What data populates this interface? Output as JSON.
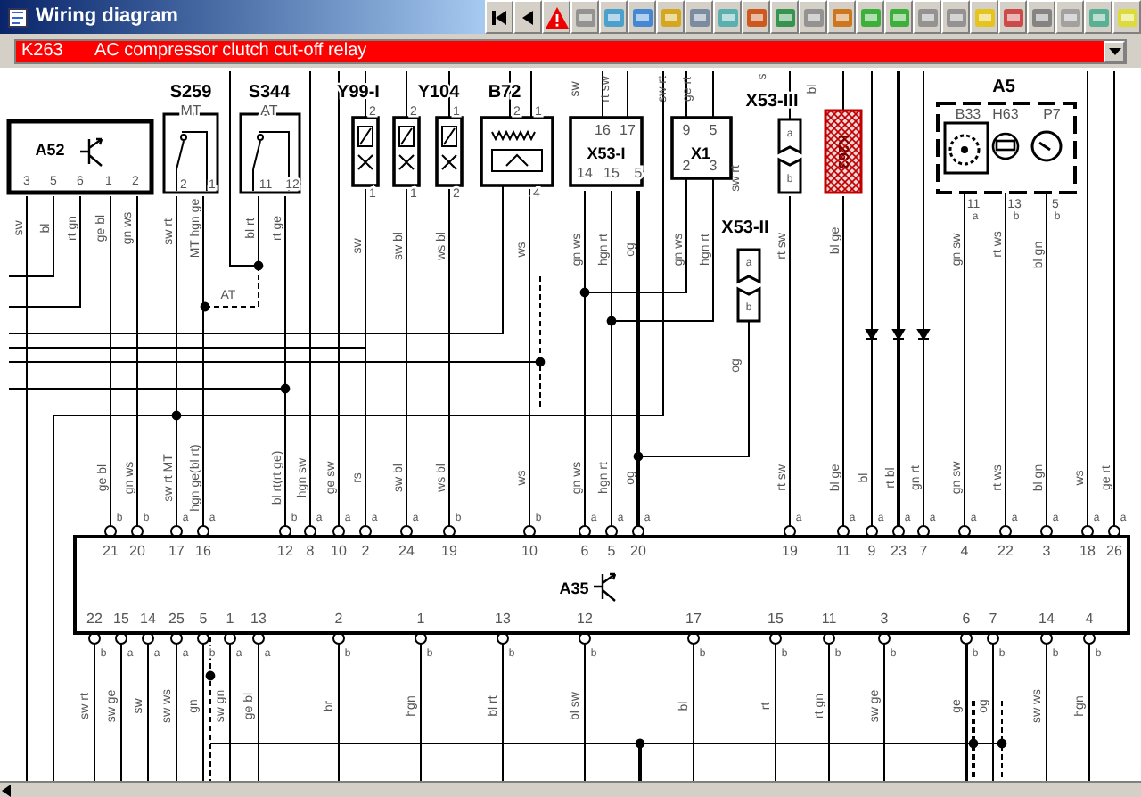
{
  "window": {
    "title": "Wiring diagram"
  },
  "component_select": {
    "code": "K263",
    "description": "AC compressor clutch cut-off relay"
  },
  "top_wire_labels": [
    "sw",
    "rt sw",
    "sw rt",
    "ge rt",
    "s",
    "bl"
  ],
  "components": [
    {
      "kind": "control-unit",
      "name": "A52",
      "bottom_pins": [
        "3",
        "5",
        "6",
        "1",
        "2"
      ],
      "wires": [
        "sw",
        "bl",
        "rt gn",
        "ge bl",
        "gn ws"
      ]
    },
    {
      "kind": "switch",
      "name": "S259",
      "sublabel": "MT",
      "bottom_pins": [
        "2",
        "1"
      ],
      "wires": [
        "sw rt",
        "MT hgn ge"
      ]
    },
    {
      "kind": "switch",
      "name": "S344",
      "sublabel": "AT",
      "bottom_pins": [
        "11",
        "12"
      ],
      "wires": [
        "bl rt",
        "rt ge"
      ]
    },
    {
      "kind": "valve",
      "name": "Y99-I",
      "top_pins": [
        "2"
      ],
      "bottom_pins": [
        "1"
      ],
      "wires": [
        "sw"
      ]
    },
    {
      "kind": "valve",
      "top_pins": [
        "2"
      ],
      "bottom_pins": [
        "1"
      ],
      "wires": [
        "sw bl"
      ]
    },
    {
      "kind": "valve",
      "name": "Y104",
      "top_pins": [
        "1"
      ],
      "bottom_pins": [
        "2"
      ],
      "wires": [
        "ws bl"
      ]
    },
    {
      "kind": "sensor",
      "name": "B72",
      "top_pins": [
        "2",
        "1"
      ],
      "bottom_pins": [
        "4"
      ],
      "wires": [
        "ws"
      ]
    },
    {
      "kind": "connector-block",
      "name": "X53-I",
      "top_pins": [
        "16",
        "17"
      ],
      "bottom_pins": [
        "14",
        "15",
        "5"
      ],
      "wires": [
        "gn ws",
        "hgn rt",
        "og"
      ]
    },
    {
      "kind": "connector-block",
      "name": "X1",
      "top_pins": [
        "9",
        "5"
      ],
      "bottom_pins": [
        "2",
        "3"
      ],
      "wires": [
        "gn ws",
        "hgn rt",
        "sw rt"
      ]
    },
    {
      "kind": "plug",
      "name": "X53-II",
      "contacts": [
        "a",
        "b"
      ],
      "wires": [
        "og"
      ]
    },
    {
      "kind": "plug",
      "name": "X53-III",
      "contacts": [
        "a",
        "b"
      ],
      "wires": [
        "rt sw"
      ]
    },
    {
      "kind": "relay",
      "name": "K263",
      "wires": [
        "bl ge"
      ]
    },
    {
      "kind": "instrument-group",
      "name": "A5",
      "parts": [
        "B33",
        "H63",
        "P7"
      ],
      "bottom_pins": [
        {
          "number": "11",
          "contact": "a"
        },
        {
          "number": "13",
          "contact": "b"
        },
        {
          "number": "5",
          "contact": "b"
        }
      ],
      "wires": [
        "gn sw",
        "rt ws",
        "bl gn"
      ]
    }
  ],
  "line_labels": [
    "AT"
  ],
  "a35": {
    "name": "A35",
    "top_pins": [
      {
        "number": "21",
        "contact": "b",
        "wire": "ge bl"
      },
      {
        "number": "20",
        "contact": "b",
        "wire": "gn ws"
      },
      {
        "number": "17",
        "contact": "a",
        "wire": "sw rt MT"
      },
      {
        "number": "16",
        "contact": "a",
        "wire": "hgn ge(bl rt)"
      },
      {
        "number": "12",
        "contact": "b",
        "wire": "bl rt(rt ge)"
      },
      {
        "number": "8",
        "contact": "a",
        "wire": "hgn sw"
      },
      {
        "number": "10",
        "contact": "a",
        "wire": "ge sw"
      },
      {
        "number": "2",
        "contact": "a",
        "wire": "rs"
      },
      {
        "number": "24",
        "contact": "a",
        "wire": "sw bl"
      },
      {
        "number": "19",
        "contact": "b",
        "wire": "ws bl"
      },
      {
        "number": "10",
        "contact": "b",
        "wire": "ws"
      },
      {
        "number": "6",
        "contact": "a",
        "wire": "gn ws"
      },
      {
        "number": "5",
        "contact": "a",
        "wire": "hgn rt"
      },
      {
        "number": "20",
        "contact": "a",
        "wire": "og"
      },
      {
        "number": "19",
        "contact": "a",
        "wire": "rt sw"
      },
      {
        "number": "11",
        "contact": "a",
        "wire": "bl ge"
      },
      {
        "number": "9",
        "contact": "a",
        "wire": "bl"
      },
      {
        "number": "23",
        "contact": "a",
        "wire": "rt bl"
      },
      {
        "number": "7",
        "contact": "a",
        "wire": "gn rt"
      },
      {
        "number": "4",
        "contact": "a",
        "wire": "gn sw"
      },
      {
        "number": "22",
        "contact": "a",
        "wire": "rt ws"
      },
      {
        "number": "3",
        "contact": "a",
        "wire": "bl gn"
      },
      {
        "number": "18",
        "contact": "a",
        "wire": "ws"
      },
      {
        "number": "26",
        "contact": "a",
        "wire": "ge rt"
      }
    ],
    "bottom_pins": [
      {
        "number": "22",
        "contact": "b",
        "wire": "sw rt"
      },
      {
        "number": "15",
        "contact": "a",
        "wire": "sw ge"
      },
      {
        "number": "14",
        "contact": "a",
        "wire": "sw"
      },
      {
        "number": "25",
        "contact": "a",
        "wire": "sw ws"
      },
      {
        "number": "5",
        "contact": "b",
        "wire": "gn"
      },
      {
        "number": "1",
        "contact": "a",
        "wire": "sw gn"
      },
      {
        "number": "13",
        "contact": "a",
        "wire": "ge bl"
      },
      {
        "number": "2",
        "contact": "b",
        "wire": "br"
      },
      {
        "number": "1",
        "contact": "b",
        "wire": "hgn"
      },
      {
        "number": "13",
        "contact": "b",
        "wire": "bl rt"
      },
      {
        "number": "12",
        "contact": "b",
        "wire": "bl sw"
      },
      {
        "number": "17",
        "contact": "b",
        "wire": "bl"
      },
      {
        "number": "15",
        "contact": "b",
        "wire": "rt"
      },
      {
        "number": "11",
        "contact": "b",
        "wire": "rt gn"
      },
      {
        "number": "3",
        "contact": "b",
        "wire": "sw ge"
      },
      {
        "number": "6",
        "contact": "b",
        "wire": "ge"
      },
      {
        "number": "7",
        "contact": "b",
        "wire": "og"
      },
      {
        "number": "14",
        "contact": "b",
        "wire": "sw ws"
      },
      {
        "number": "4",
        "contact": "b",
        "wire": "hgn"
      }
    ]
  }
}
